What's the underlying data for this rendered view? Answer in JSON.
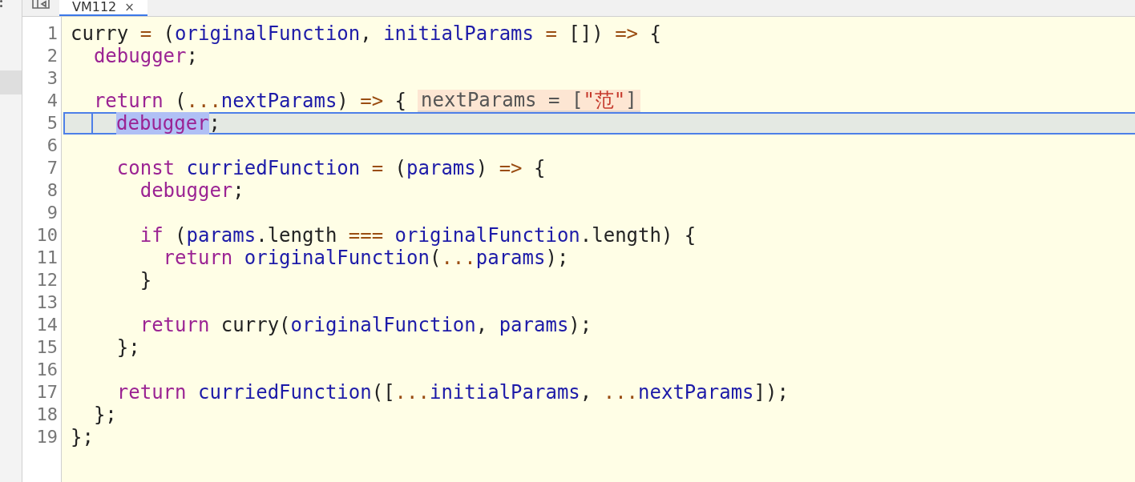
{
  "tab": {
    "title": "VM112",
    "close": "×",
    "selected": true
  },
  "lines": [
    {
      "number": "1",
      "current": false,
      "tokens": [
        {
          "text": "curry ",
          "kind": "plain"
        },
        {
          "text": "=",
          "kind": "op"
        },
        {
          "text": " (",
          "kind": "plain"
        },
        {
          "text": "originalFunction",
          "kind": "var"
        },
        {
          "text": ", ",
          "kind": "plain"
        },
        {
          "text": "initialParams ",
          "kind": "var"
        },
        {
          "text": "=",
          "kind": "op"
        },
        {
          "text": " []) ",
          "kind": "plain"
        },
        {
          "text": "=>",
          "kind": "op"
        },
        {
          "text": " {",
          "kind": "plain"
        }
      ]
    },
    {
      "number": "2",
      "current": false,
      "tokens": [
        {
          "text": "  debugger",
          "kind": "kw"
        },
        {
          "text": ";",
          "kind": "plain"
        }
      ]
    },
    {
      "number": "3",
      "current": false
    },
    {
      "number": "4",
      "current": false,
      "tokens": [
        {
          "text": "  return",
          "kind": "kw"
        },
        {
          "text": " (",
          "kind": "plain"
        },
        {
          "text": "...",
          "kind": "op"
        },
        {
          "text": "nextParams",
          "kind": "var"
        },
        {
          "text": ") ",
          "kind": "plain"
        },
        {
          "text": "=>",
          "kind": "op"
        },
        {
          "text": " {",
          "kind": "plain"
        }
      ],
      "inline_value": [
        {
          "text": "nextParams = [",
          "kind": "dim"
        },
        {
          "text": "\"范\"",
          "kind": "str"
        },
        {
          "text": "]",
          "kind": "dim"
        }
      ]
    },
    {
      "number": "5",
      "current": true,
      "tokens": [
        {
          "text": "debugger",
          "kind": "kw",
          "selected": true
        },
        {
          "text": ";",
          "kind": "plain",
          "selected": false
        }
      ]
    },
    {
      "number": "6",
      "current": false
    },
    {
      "number": "7",
      "current": false,
      "tokens": [
        {
          "text": "    const",
          "kind": "kw"
        },
        {
          "text": " curriedFunction ",
          "kind": "var"
        },
        {
          "text": "=",
          "kind": "op"
        },
        {
          "text": " (",
          "kind": "plain"
        },
        {
          "text": "params",
          "kind": "var"
        },
        {
          "text": ") ",
          "kind": "plain"
        },
        {
          "text": "=>",
          "kind": "op"
        },
        {
          "text": " {",
          "kind": "plain"
        }
      ]
    },
    {
      "number": "8",
      "current": false,
      "tokens": [
        {
          "text": "      debugger",
          "kind": "kw"
        },
        {
          "text": ";",
          "kind": "plain"
        }
      ]
    },
    {
      "number": "9",
      "current": false
    },
    {
      "number": "10",
      "current": false,
      "tokens": [
        {
          "text": "      if",
          "kind": "kw"
        },
        {
          "text": " (",
          "kind": "plain"
        },
        {
          "text": "params",
          "kind": "var"
        },
        {
          "text": ".length ",
          "kind": "plain"
        },
        {
          "text": "===",
          "kind": "op"
        },
        {
          "text": " originalFunction",
          "kind": "var"
        },
        {
          "text": ".length) {",
          "kind": "plain"
        }
      ]
    },
    {
      "number": "11",
      "current": false,
      "tokens": [
        {
          "text": "        return",
          "kind": "kw"
        },
        {
          "text": " originalFunction",
          "kind": "var"
        },
        {
          "text": "(",
          "kind": "plain"
        },
        {
          "text": "...",
          "kind": "op"
        },
        {
          "text": "params",
          "kind": "var"
        },
        {
          "text": ");",
          "kind": "plain"
        }
      ]
    },
    {
      "number": "12",
      "current": false,
      "tokens": [
        {
          "text": "      }",
          "kind": "plain"
        }
      ]
    },
    {
      "number": "13",
      "current": false
    },
    {
      "number": "14",
      "current": false,
      "tokens": [
        {
          "text": "      return",
          "kind": "kw"
        },
        {
          "text": " curry(",
          "kind": "plain"
        },
        {
          "text": "originalFunction",
          "kind": "var"
        },
        {
          "text": ", ",
          "kind": "plain"
        },
        {
          "text": "params",
          "kind": "var"
        },
        {
          "text": ");",
          "kind": "plain"
        }
      ]
    },
    {
      "number": "15",
      "current": false,
      "tokens": [
        {
          "text": "    };",
          "kind": "plain"
        }
      ]
    },
    {
      "number": "16",
      "current": false
    },
    {
      "number": "17",
      "current": false,
      "tokens": [
        {
          "text": "    return",
          "kind": "kw"
        },
        {
          "text": " curriedFunction",
          "kind": "var"
        },
        {
          "text": "([",
          "kind": "plain"
        },
        {
          "text": "...",
          "kind": "op"
        },
        {
          "text": "initialParams",
          "kind": "var"
        },
        {
          "text": ", ",
          "kind": "plain"
        },
        {
          "text": "...",
          "kind": "op"
        },
        {
          "text": "nextParams",
          "kind": "var"
        },
        {
          "text": "]);",
          "kind": "plain"
        }
      ]
    },
    {
      "number": "18",
      "current": false,
      "tokens": [
        {
          "text": "  };",
          "kind": "plain"
        }
      ]
    },
    {
      "number": "19",
      "current": false,
      "tokens": [
        {
          "text": "};",
          "kind": "plain"
        }
      ]
    }
  ]
}
